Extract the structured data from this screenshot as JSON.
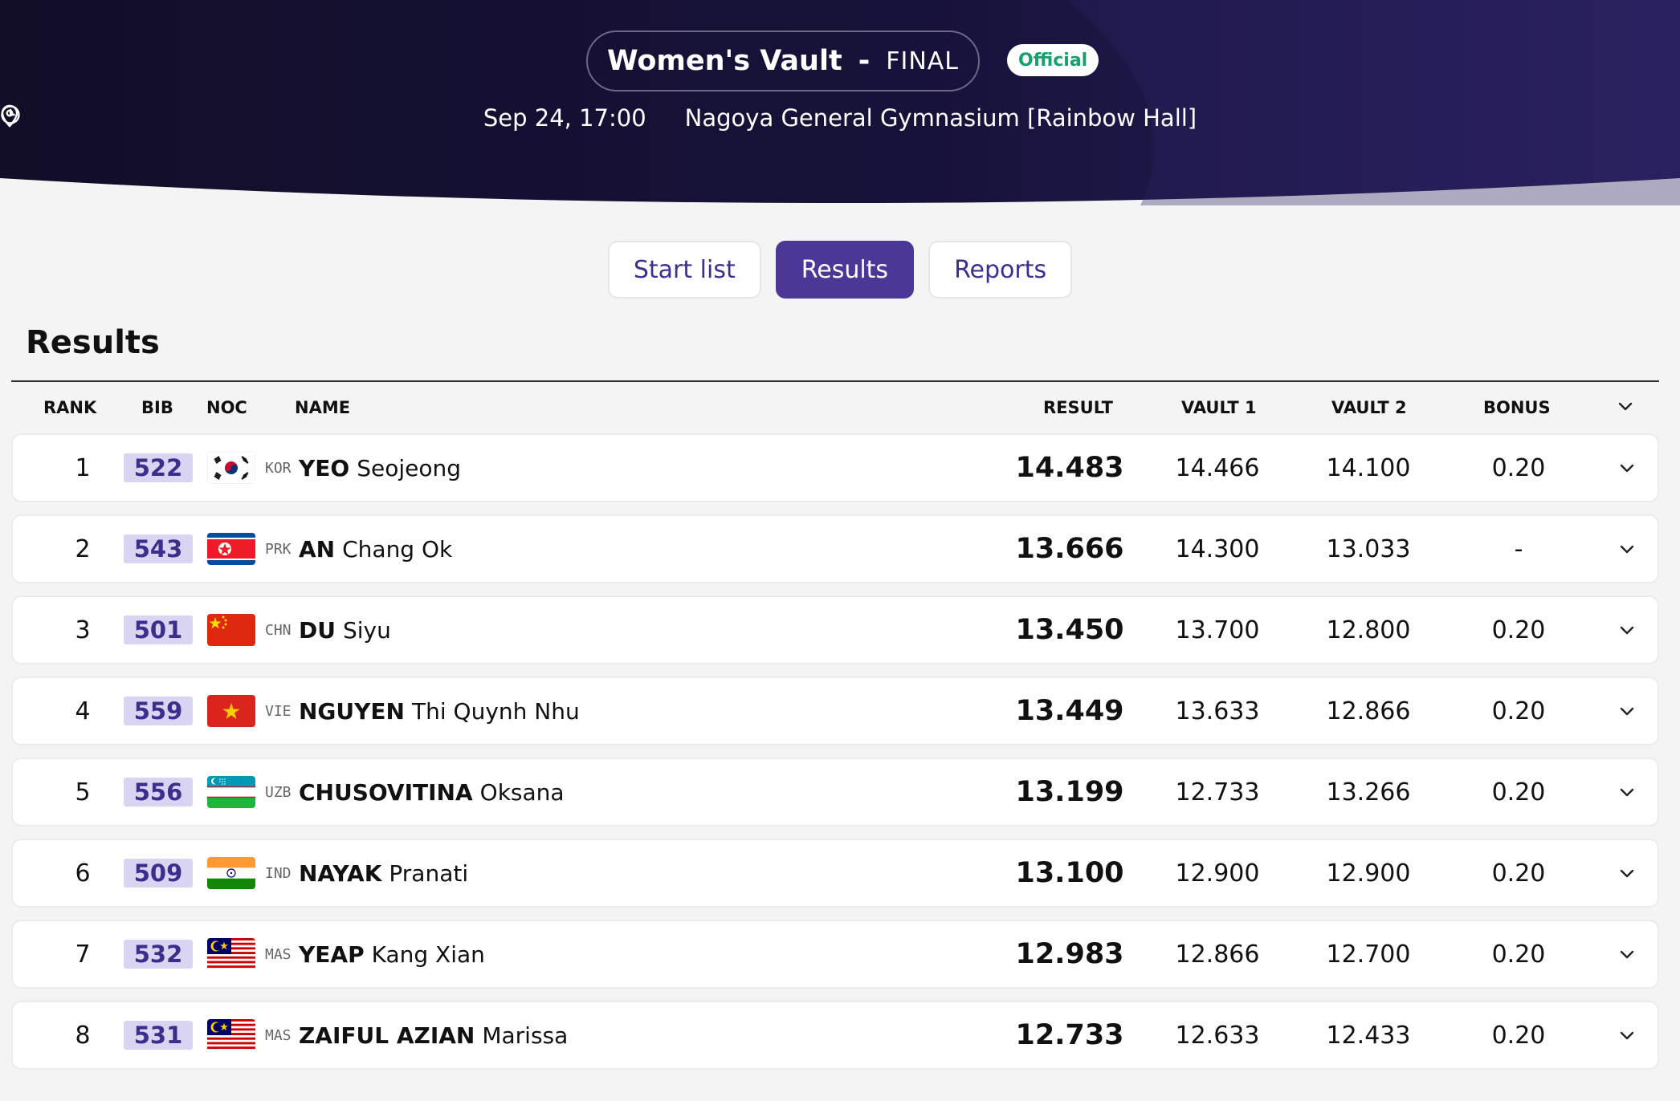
{
  "header": {
    "event": "Women's Vault",
    "separator": "-",
    "phase": "FINAL",
    "status": "Official",
    "datetime": "Sep 24, 17:00",
    "venue": "Nagoya General Gymnasium [Rainbow Hall]"
  },
  "tabs": [
    {
      "label": "Start list",
      "active": false
    },
    {
      "label": "Results",
      "active": true
    },
    {
      "label": "Reports",
      "active": false
    }
  ],
  "section_title": "Results",
  "columns": {
    "rank": "RANK",
    "bib": "BIB",
    "noc": "NOC",
    "name": "NAME",
    "result": "RESULT",
    "vault1": "VAULT 1",
    "vault2": "VAULT 2",
    "bonus": "BONUS"
  },
  "rows": [
    {
      "rank": "1",
      "bib": "522",
      "noc": "KOR",
      "flag": "flag-kor",
      "surname": "YEO",
      "given": "Seojeong",
      "result": "14.483",
      "vault1": "14.466",
      "vault2": "14.100",
      "bonus": "0.20"
    },
    {
      "rank": "2",
      "bib": "543",
      "noc": "PRK",
      "flag": "flag-prk",
      "surname": "AN",
      "given": "Chang Ok",
      "result": "13.666",
      "vault1": "14.300",
      "vault2": "13.033",
      "bonus": "-"
    },
    {
      "rank": "3",
      "bib": "501",
      "noc": "CHN",
      "flag": "flag-chn",
      "surname": "DU",
      "given": "Siyu",
      "result": "13.450",
      "vault1": "13.700",
      "vault2": "12.800",
      "bonus": "0.20"
    },
    {
      "rank": "4",
      "bib": "559",
      "noc": "VIE",
      "flag": "flag-vie",
      "surname": "NGUYEN",
      "given": "Thi Quynh Nhu",
      "result": "13.449",
      "vault1": "13.633",
      "vault2": "12.866",
      "bonus": "0.20"
    },
    {
      "rank": "5",
      "bib": "556",
      "noc": "UZB",
      "flag": "flag-uzb",
      "surname": "CHUSOVITINA",
      "given": "Oksana",
      "result": "13.199",
      "vault1": "12.733",
      "vault2": "13.266",
      "bonus": "0.20"
    },
    {
      "rank": "6",
      "bib": "509",
      "noc": "IND",
      "flag": "flag-ind",
      "surname": "NAYAK",
      "given": "Pranati",
      "result": "13.100",
      "vault1": "12.900",
      "vault2": "12.900",
      "bonus": "0.20"
    },
    {
      "rank": "7",
      "bib": "532",
      "noc": "MAS",
      "flag": "flag-mas",
      "surname": "YEAP",
      "given": "Kang Xian",
      "result": "12.983",
      "vault1": "12.866",
      "vault2": "12.700",
      "bonus": "0.20"
    },
    {
      "rank": "8",
      "bib": "531",
      "noc": "MAS",
      "flag": "flag-mas",
      "surname": "ZAIFUL AZIAN",
      "given": "Marissa",
      "result": "12.733",
      "vault1": "12.633",
      "vault2": "12.433",
      "bonus": "0.20"
    }
  ],
  "icons": {
    "clock": "clock-icon",
    "location": "map-pin-icon",
    "expand": "chevron-down-icon"
  },
  "colors": {
    "header_bg": "#140f2e",
    "accent": "#4b3896",
    "bib_bg": "#d9d4f1",
    "official": "#16a06a"
  }
}
